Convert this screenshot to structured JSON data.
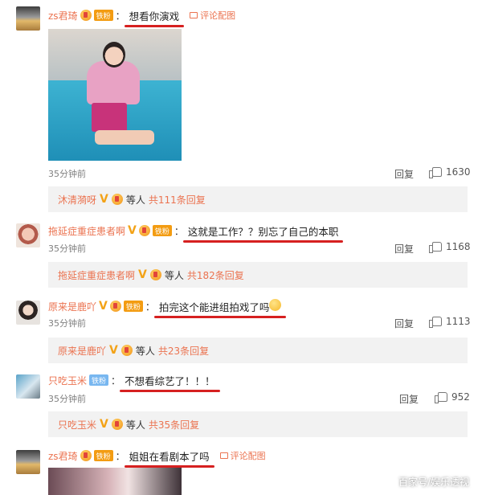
{
  "comments": [
    {
      "username": "zs君琦",
      "badge": "铁粉",
      "text": "想看你演戏",
      "pic_link": "评论配图",
      "time": "35分钟前",
      "reply_label": "回复",
      "likes": "1630",
      "subreply": {
        "user": "沐清漪呀",
        "etc": "等人",
        "count": "共111条回复"
      }
    },
    {
      "username": "拖延症重症患者啊",
      "badge": "铁粉",
      "text": "这就是工作？？别忘了自己的本职",
      "time": "35分钟前",
      "reply_label": "回复",
      "likes": "1168",
      "subreply": {
        "user": "拖延症重症患者啊",
        "etc": "等人",
        "count": "共182条回复"
      }
    },
    {
      "username": "原来是鹿吖",
      "badge": "铁粉",
      "text": "拍完这个能进组拍戏了吗",
      "time": "35分钟前",
      "reply_label": "回复",
      "likes": "1113",
      "subreply": {
        "user": "原来是鹿吖",
        "etc": "等人",
        "count": "共23条回复"
      }
    },
    {
      "username": "只吃玉米",
      "badge": "铁粉",
      "text": "不想看综艺了！！！",
      "time": "35分钟前",
      "reply_label": "回复",
      "likes": "952",
      "subreply": {
        "user": "只吃玉米",
        "etc": "等人",
        "count": "共35条回复"
      }
    },
    {
      "username": "zs君琦",
      "badge": "铁粉",
      "text": "姐姐在看剧本了吗",
      "pic_link": "评论配图"
    }
  ],
  "watermark": "百家号/娱乐透视",
  "colors": {
    "username": "#eb7350",
    "underline": "#d62020",
    "subreply_bg": "#f2f2f2"
  }
}
